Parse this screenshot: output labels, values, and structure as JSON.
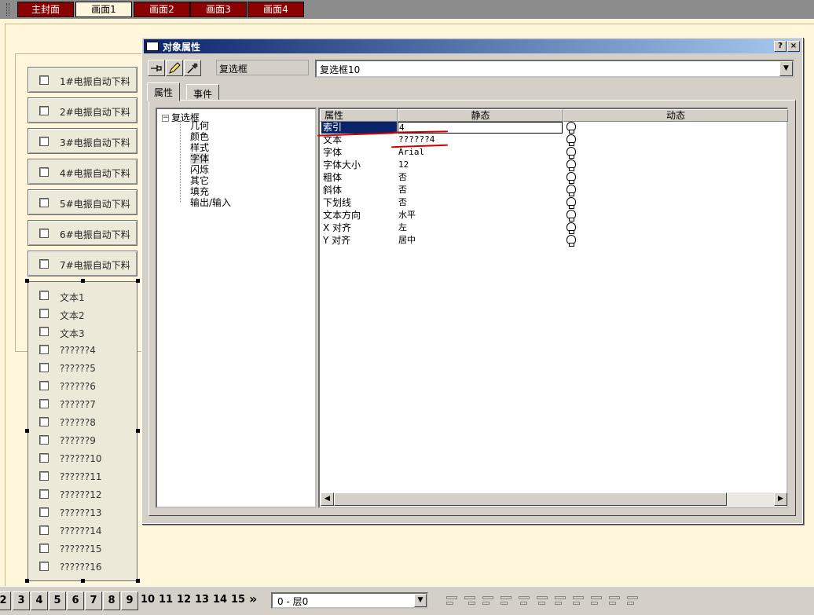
{
  "screen_tabs": [
    "主封面",
    "画面1",
    "画面2",
    "画面3",
    "画面4"
  ],
  "active_screen_tab": 1,
  "canvas": {
    "buttons": [
      "1#电振自动下料",
      "2#电振自动下料",
      "3#电振自动下料",
      "4#电振自动下料",
      "5#电振自动下料",
      "6#电振自动下料",
      "7#电振自动下料"
    ],
    "checklist": [
      "文本1",
      "文本2",
      "文本3",
      "??????4",
      "??????5",
      "??????6",
      "??????7",
      "??????8",
      "??????9",
      "??????10",
      "??????11",
      "??????12",
      "??????13",
      "??????14",
      "??????15",
      "??????16"
    ]
  },
  "dialog": {
    "title": "对象属性",
    "help_label": "?",
    "close_label": "×",
    "object_type": "复选框",
    "object_name": "复选框10",
    "tabs": [
      "属性",
      "事件"
    ],
    "tree": {
      "root": "复选框",
      "children": [
        "几何",
        "颜色",
        "样式",
        "字体",
        "闪烁",
        "其它",
        "填充",
        "输出/输入"
      ],
      "selected_child": "字体"
    },
    "grid": {
      "headers": [
        "属性",
        "静态",
        "动态"
      ],
      "rows": [
        {
          "name": "索引",
          "static": "4"
        },
        {
          "name": "文本",
          "static": "??????4"
        },
        {
          "name": "字体",
          "static": "Arial"
        },
        {
          "name": "字体大小",
          "static": "12"
        },
        {
          "name": "粗体",
          "static": "否"
        },
        {
          "name": "斜体",
          "static": "否"
        },
        {
          "name": "下划线",
          "static": "否"
        },
        {
          "name": "文本方向",
          "static": "水平"
        },
        {
          "name": "X 对齐",
          "static": "左"
        },
        {
          "name": "Y 对齐",
          "static": "居中"
        }
      ],
      "selected_row": 0,
      "dynamic_icon": "bulb-icon"
    }
  },
  "bottom": {
    "layers": [
      "2",
      "3",
      "4",
      "5",
      "6",
      "7",
      "8",
      "9"
    ],
    "layers_flat": [
      "10",
      "11",
      "12",
      "13",
      "14",
      "15"
    ],
    "more_label": "»",
    "layer_combo": "0 - 层0"
  },
  "colors": {
    "tab_red": "#8b0000",
    "canvas_bg": "#fff6dc",
    "annotation_red": "#d40000",
    "title_blue": "#0a246a"
  }
}
